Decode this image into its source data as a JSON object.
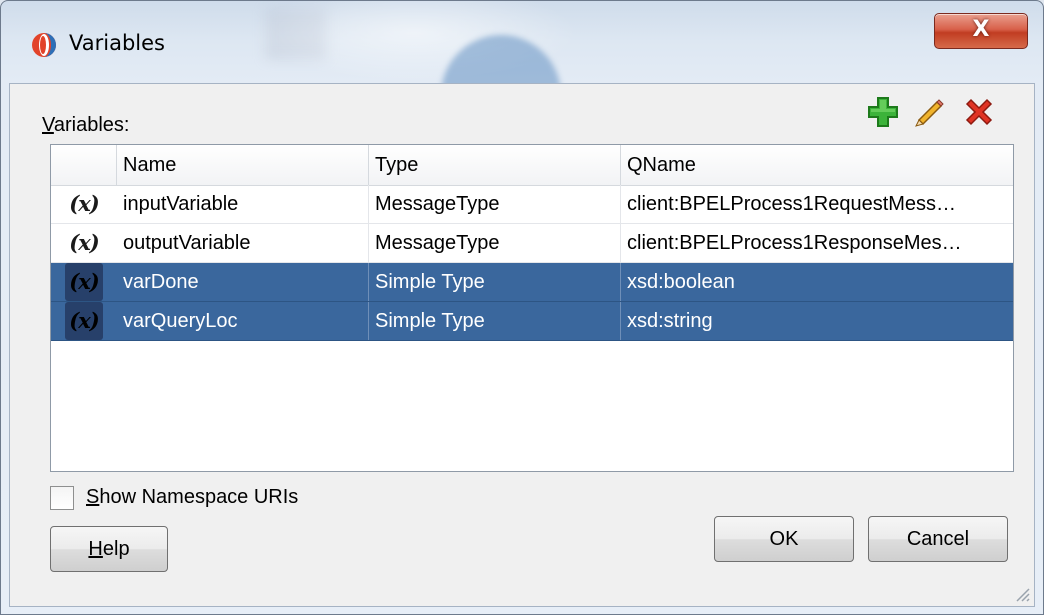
{
  "window": {
    "title": "Variables",
    "close_label": "X"
  },
  "section_label": {
    "mnemonic": "V",
    "rest": "ariables:"
  },
  "toolbar": {
    "add_icon": "green-plus-icon",
    "edit_icon": "pencil-icon",
    "delete_icon": "red-x-icon"
  },
  "table": {
    "headers": [
      "",
      "Name",
      "Type",
      "QName"
    ],
    "rows": [
      {
        "icon": "(x)",
        "name": "inputVariable",
        "type": "MessageType",
        "qname": "client:BPELProcess1RequestMess…",
        "selected": false
      },
      {
        "icon": "(x)",
        "name": "outputVariable",
        "type": "MessageType",
        "qname": "client:BPELProcess1ResponseMes…",
        "selected": false
      },
      {
        "icon": "(x)",
        "name": "varDone",
        "type": "Simple Type",
        "qname": "xsd:boolean",
        "selected": true
      },
      {
        "icon": "(x)",
        "name": "varQueryLoc",
        "type": "Simple Type",
        "qname": "xsd:string",
        "selected": true
      }
    ]
  },
  "options": {
    "show_ns_mnemonic": "S",
    "show_ns_rest": "how Namespace URIs",
    "show_ns_checked": false
  },
  "buttons": {
    "help_mnemonic": "H",
    "help_rest": "elp",
    "ok": "OK",
    "cancel": "Cancel"
  },
  "colors": {
    "selection": "#3a679d",
    "close_button": "#c13d22",
    "add_icon": "#2ea32b",
    "delete_icon": "#d42b1e"
  }
}
